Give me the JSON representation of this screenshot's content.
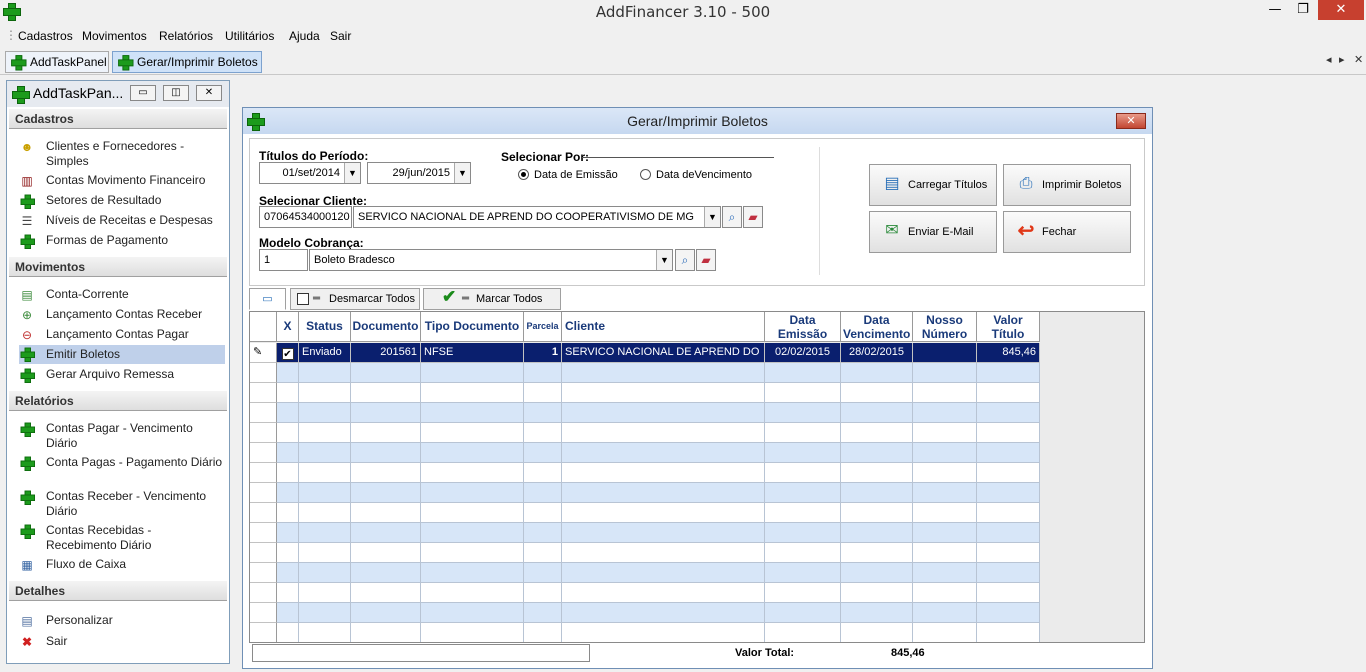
{
  "window": {
    "title": "AddFinancer 3.10 - 500",
    "minimize": "—",
    "restore": "❐",
    "close": "✕"
  },
  "menu": [
    "Cadastros",
    "Movimentos",
    "Relatórios",
    "Utilitários",
    "Ajuda",
    "Sair"
  ],
  "tabs": [
    {
      "label": "AddTaskPanel"
    },
    {
      "label": "Gerar/Imprimir Boletos"
    }
  ],
  "tabs_nav": {
    "left": "◂",
    "right": "▸",
    "close": "✕"
  },
  "taskpanel": {
    "title": "AddTaskPan...",
    "sections": [
      {
        "title": "Cadastros",
        "items": [
          {
            "label": "Clientes e Fornecedores - Simples",
            "icon": "people-icon"
          },
          {
            "label": "Contas Movimento Financeiro",
            "icon": "bank-icon"
          },
          {
            "label": "Setores de Resultado",
            "icon": "plus-icon"
          },
          {
            "label": "Níveis de Receitas e Despesas",
            "icon": "list-icon"
          },
          {
            "label": "Formas de Pagamento",
            "icon": "plus-icon"
          }
        ]
      },
      {
        "title": "Movimentos",
        "items": [
          {
            "label": "Conta-Corrente",
            "icon": "money-icon"
          },
          {
            "label": "Lançamento Contas Receber",
            "icon": "receive-icon"
          },
          {
            "label": "Lançamento Contas Pagar",
            "icon": "pay-icon"
          },
          {
            "label": "Emitir Boletos",
            "icon": "plus-icon"
          },
          {
            "label": "Gerar Arquivo Remessa",
            "icon": "plus-icon"
          }
        ]
      },
      {
        "title": "Relatórios",
        "items": [
          {
            "label": "Contas Pagar - Vencimento Diário",
            "icon": "plus-icon"
          },
          {
            "label": "Conta Pagas - Pagamento Diário",
            "icon": "plus-icon"
          },
          {
            "label": "Contas Receber - Vencimento Diário",
            "icon": "plus-icon"
          },
          {
            "label": "Contas Recebidas - Recebimento Diário",
            "icon": "plus-icon"
          },
          {
            "label": "Fluxo de Caixa",
            "icon": "chart-icon"
          }
        ]
      },
      {
        "title": "Detalhes",
        "items": [
          {
            "label": "Personalizar",
            "icon": "customize-icon"
          },
          {
            "label": "Sair",
            "icon": "exit-icon"
          }
        ]
      }
    ]
  },
  "dialog": {
    "title": "Gerar/Imprimir Boletos",
    "period_label": "Títulos do Período:",
    "date_from": "01/set/2014",
    "date_to": "29/jun/2015",
    "select_by_label": "Selecionar Por:",
    "radio_emissao": "Data de Emissão",
    "radio_vencimento": "Data deVencimento",
    "client_label": "Selecionar Cliente:",
    "client_code": "07064534000120",
    "client_name": "SERVICO NACIONAL DE APREND DO COOPERATIVISMO DE MG",
    "modelo_label": "Modelo Cobrança:",
    "modelo_code": "1",
    "modelo_name": "Boleto Bradesco",
    "btn_carregar": "Carregar Títulos",
    "btn_imprimir": "Imprimir Boletos",
    "btn_email": "Enviar E-Mail",
    "btn_fechar": "Fechar",
    "btn_desmarcar": "Desmarcar Todos",
    "btn_marcar": "Marcar Todos",
    "columns": [
      "X",
      "Status",
      "Documento",
      "Tipo Documento",
      "Parcela",
      "Cliente",
      "Data Emissão",
      "Data Vencimento",
      "Nosso Número",
      "Valor Título"
    ],
    "rows": [
      {
        "status": "Enviado",
        "documento": "201561",
        "tipo": "NFSE",
        "parcela": "1",
        "cliente": "SERVICO NACIONAL DE APREND DO",
        "emissao": "02/02/2015",
        "vencimento": "28/02/2015",
        "nosso": "",
        "valor": "845,46"
      }
    ],
    "total_label": "Valor Total:",
    "total_value": "845,46"
  },
  "colors": {
    "row_selected": "#0a1f6e",
    "row_alt": "#d7e6f8",
    "header_text": "#1a3a7a"
  }
}
